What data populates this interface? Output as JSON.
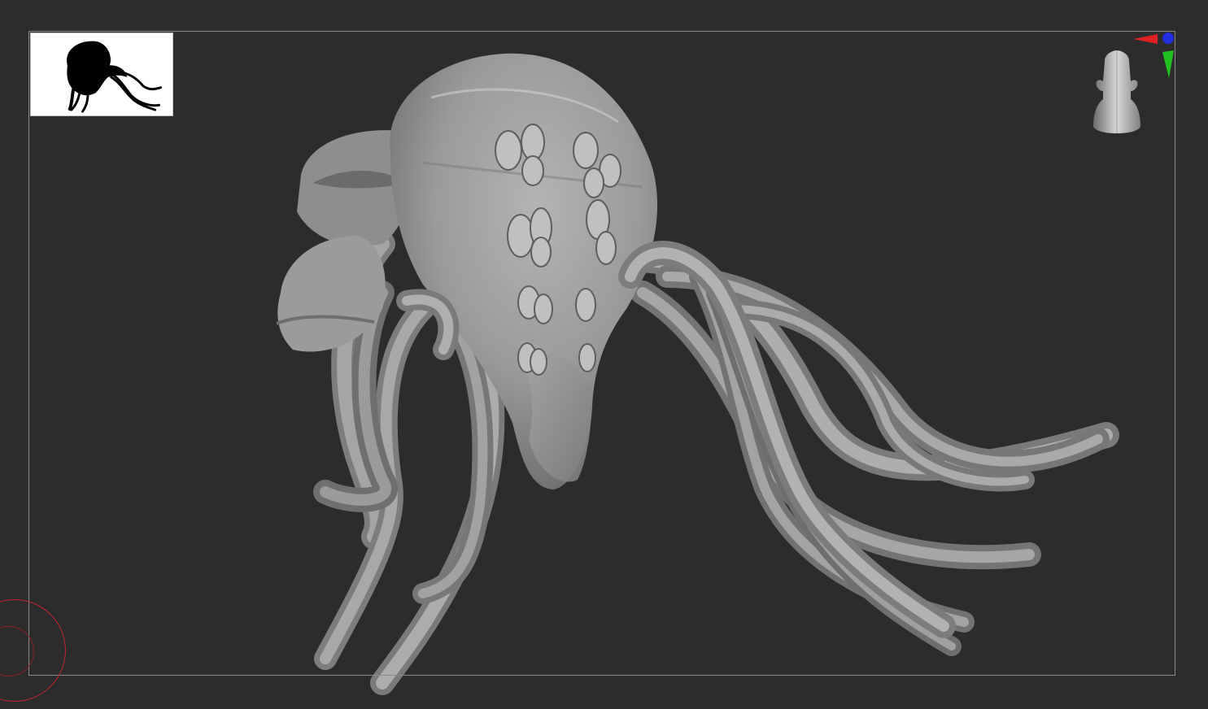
{
  "viewport": {
    "background_color": "#2c2c2c",
    "frame_color": "#8a8a8a"
  },
  "thumbnail": {
    "icon": "creature-silhouette-icon",
    "background_color": "#ffffff",
    "silhouette_color": "#000000"
  },
  "model": {
    "icon": "tentacled-creature-sculpt",
    "surface_color": "#9a9a9a"
  },
  "axis_gizmo": {
    "icon": "axis-gizmo-icon",
    "x_color": "#e02020",
    "y_color": "#20c020",
    "z_color": "#2030e0"
  },
  "navigation": {
    "icon": "head-navigation-icon"
  },
  "brush_cursor": {
    "icon": "brush-cursor-icon",
    "color": "#c0272d"
  }
}
